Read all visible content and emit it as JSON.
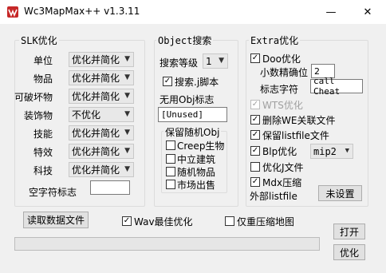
{
  "window": {
    "title": "Wc3MapMax++ v1.3.11",
    "minimize": "—",
    "close": "✕"
  },
  "slk": {
    "group_label": "SLK优化",
    "rows": [
      {
        "label": "单位",
        "value": "优化并简化"
      },
      {
        "label": "物品",
        "value": "优化并简化"
      },
      {
        "label": "可破坏物",
        "value": "优化并简化"
      },
      {
        "label": "装饰物",
        "value": "不优化"
      },
      {
        "label": "技能",
        "value": "优化并简化"
      },
      {
        "label": "特效",
        "value": "优化并简化"
      },
      {
        "label": "科技",
        "value": "优化并简化"
      }
    ],
    "empty_char_label": "空字符标志",
    "empty_char_value": ""
  },
  "object": {
    "group_label": "Object搜索",
    "level_label": "搜索等级",
    "level_value": "1",
    "search_j_label": "搜索.j脚本",
    "search_j_checked": "✓",
    "unused_label": "无用Obj标志",
    "unused_value": "[Unused]",
    "keep_label": "保留随机Obj",
    "keep_items": [
      {
        "label": "Creep生物",
        "checked": ""
      },
      {
        "label": "中立建筑",
        "checked": ""
      },
      {
        "label": "随机物品",
        "checked": ""
      },
      {
        "label": "市场出售",
        "checked": ""
      }
    ]
  },
  "extra": {
    "group_label": "Extra优化",
    "doo_label": "Doo优化",
    "doo_checked": "✓",
    "decimal_label": "小数精确位",
    "decimal_value": "2",
    "marker_label": "标志字符",
    "marker_value": "call Cheat",
    "wts_label": "WTS优化",
    "wts_checked": "✓",
    "delete_we_label": "删除WE关联文件",
    "delete_we_checked": "✓",
    "keep_listfile_label": "保留listfile文件",
    "keep_listfile_checked": "✓",
    "blp_label": "Blp优化",
    "blp_checked": "✓",
    "blp_mode": "mip2",
    "optimize_j_label": "优化J文件",
    "optimize_j_checked": "",
    "mdx_label": "Mdx压缩",
    "mdx_checked": "✓",
    "external_listfile_label": "外部listfile",
    "not_set_button": "未设置"
  },
  "bottom": {
    "read_data_button": "读取数据文件",
    "wav_label": "Wav最佳优化",
    "wav_checked": "✓",
    "recompress_label": "仅重压缩地图",
    "recompress_checked": "",
    "open_button": "打开",
    "optimize_button": "优化"
  },
  "colors": {
    "background": "#f0f0f0",
    "titlebar": "#ffffff",
    "disabled_text": "#a0a0a0",
    "icon_red": "#c62828"
  }
}
